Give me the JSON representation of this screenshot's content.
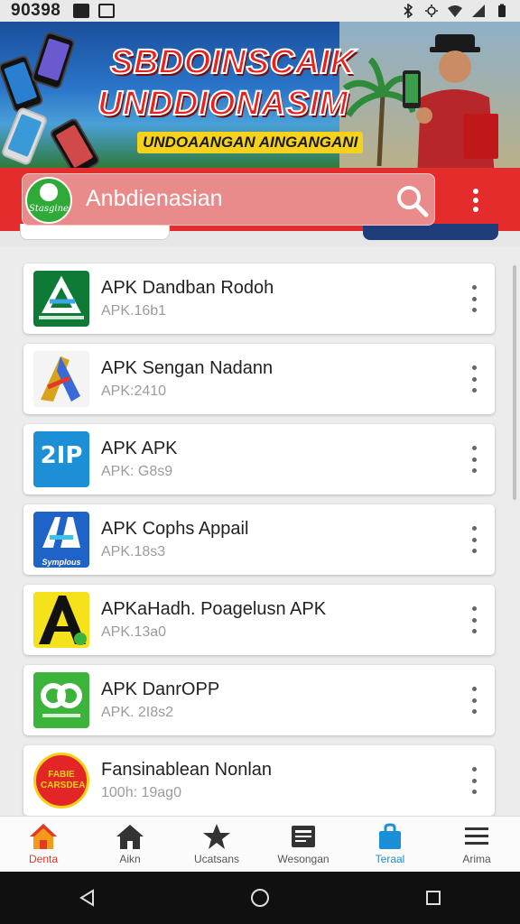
{
  "status_bar": {
    "time": "90398"
  },
  "banner": {
    "title_line1": "SBDOINSCAIK",
    "title_line2": "UNDDIONASIM",
    "subtitle": "UNDOAANGAN AINGANGANI"
  },
  "header": {
    "logo_text": "Stasgine",
    "search_text": "Anbdienasian",
    "search_icon": "search-icon",
    "more_icon": "more-vertical-icon"
  },
  "apps": [
    {
      "title": "APK Dandban Rodoh",
      "subtitle": "APK.16b1",
      "icon_label": "",
      "icon_colors": [
        "#0e7a35",
        "#ffffff"
      ]
    },
    {
      "title": "APK Sengan Nadann",
      "subtitle": "APK:2410",
      "icon_label": "",
      "icon_colors": [
        "#f2f2f2",
        "#d9a21a"
      ]
    },
    {
      "title": "APK APK",
      "subtitle": "APK: G8s9",
      "icon_label": "2IP",
      "icon_colors": [
        "#1c8fd6",
        "#ffffff"
      ]
    },
    {
      "title": "APK Cophs Appail",
      "subtitle": "APK.18s3",
      "icon_label": "Symplous",
      "icon_colors": [
        "#1f63c8",
        "#ffffff"
      ]
    },
    {
      "title": "APKaHadh. Poagelusn APK",
      "subtitle": "APK.13a0",
      "icon_label": "",
      "icon_colors": [
        "#f6e21a",
        "#111111"
      ]
    },
    {
      "title": "APK DanrOPP",
      "subtitle": "APK. 2I8s2",
      "icon_label": "",
      "icon_colors": [
        "#3cb43c",
        "#ffffff"
      ]
    },
    {
      "title": "Fansinablean Nonlan",
      "subtitle": "100h: 19ag0",
      "icon_label": "FABIE CARSDEA",
      "icon_colors": [
        "#e32525",
        "#f4d21c"
      ]
    }
  ],
  "bottom_nav": [
    {
      "label": "Denta",
      "icon": "home-icon",
      "state": "active"
    },
    {
      "label": "Aikn",
      "icon": "house-icon",
      "state": "normal"
    },
    {
      "label": "Ucatsans",
      "icon": "star-icon",
      "state": "normal"
    },
    {
      "label": "Wesongan",
      "icon": "news-icon",
      "state": "normal"
    },
    {
      "label": "Teraal",
      "icon": "bag-icon",
      "state": "blue"
    },
    {
      "label": "Arima",
      "icon": "menu-icon",
      "state": "normal"
    }
  ],
  "system_nav": {
    "back": "back-icon",
    "home": "home-circle-icon",
    "recents": "recents-icon"
  },
  "colors": {
    "header_red": "#e42c2c",
    "nav_active": "#e23a25",
    "nav_blue": "#1a8fd8"
  }
}
